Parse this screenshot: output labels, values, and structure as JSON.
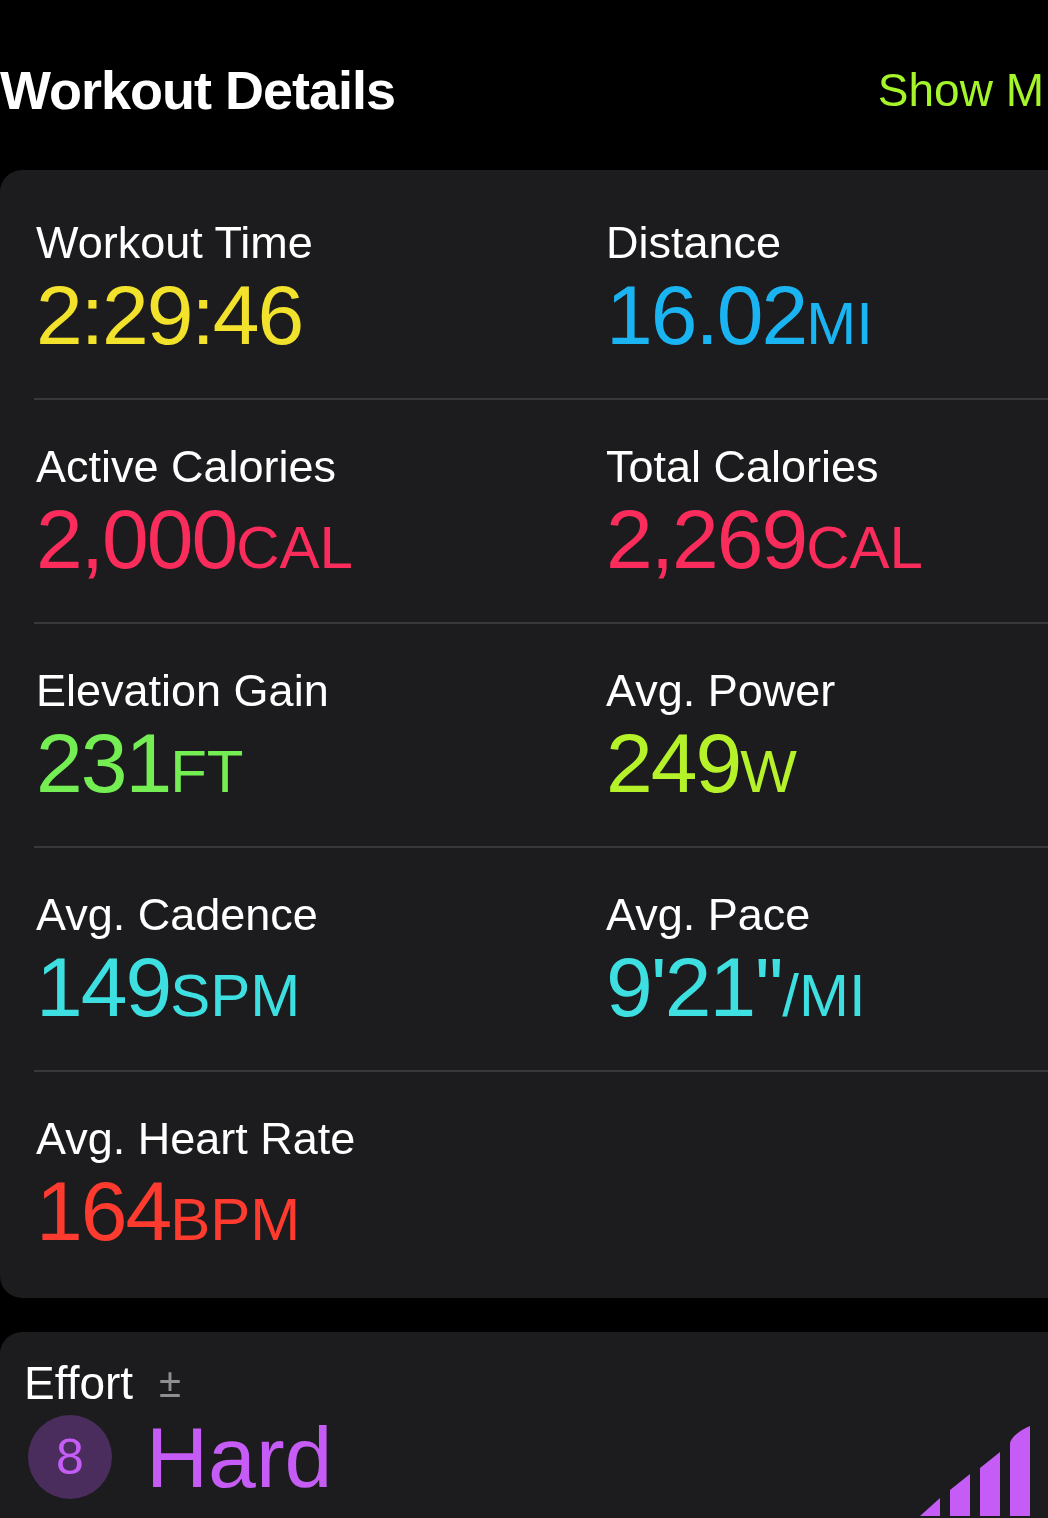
{
  "header": {
    "title": "Workout Details",
    "action": "Show M"
  },
  "metrics": [
    {
      "label": "Workout Time",
      "value": "2:29:46",
      "color": "#f2e22c"
    },
    {
      "label": "Distance",
      "value": "16.02",
      "unit": "MI",
      "color": "#1ab4f2"
    },
    {
      "label": "Active Calories",
      "value": "2,000",
      "unit": "CAL",
      "color": "#fa2c5c"
    },
    {
      "label": "Total Calories",
      "value": "2,269",
      "unit": "CAL",
      "color": "#fa2c5c"
    },
    {
      "label": "Elevation Gain",
      "value": "231",
      "unit": "FT",
      "color": "#74ee52"
    },
    {
      "label": "Avg. Power",
      "value": "249",
      "unit": "W",
      "color": "#b5f22a"
    },
    {
      "label": "Avg. Cadence",
      "value": "149",
      "unit": "SPM",
      "color": "#3ddfe0"
    },
    {
      "label": "Avg. Pace",
      "value": "9'21''",
      "unit": "/MI",
      "color": "#3ddfe0"
    },
    {
      "label": "Avg. Heart Rate",
      "value": "164",
      "unit": "BPM",
      "color": "#ff3b2f"
    }
  ],
  "effort": {
    "label": "Effort",
    "icon": "±",
    "score": "8",
    "rating": "Hard"
  }
}
